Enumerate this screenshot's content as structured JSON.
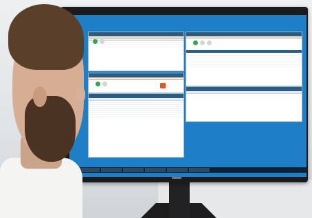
{
  "scene": {
    "description_colors": {
      "desktop_blue": "#1f7fc6",
      "window_title": "#2a5d86",
      "accent_orange": "#e8541f",
      "status_green": "#2fa84f",
      "taskbar": "#0e2233"
    }
  },
  "windows": [
    {
      "id": "w1",
      "rows": 4
    },
    {
      "id": "w2",
      "rows": 1
    },
    {
      "id": "w3",
      "rows": 9
    },
    {
      "id": "w4",
      "rows": 8
    },
    {
      "id": "w5",
      "rows": 1
    }
  ]
}
